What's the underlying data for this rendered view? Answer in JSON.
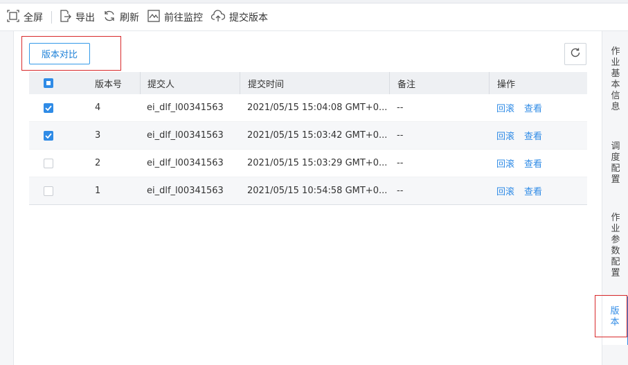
{
  "toolbar": {
    "fullscreen": "全屏",
    "export": "导出",
    "refresh": "刷新",
    "monitor": "前往监控",
    "submit": "提交版本"
  },
  "content": {
    "compare_button": "版本对比"
  },
  "table": {
    "headers": {
      "version": "版本号",
      "submitter": "提交人",
      "time": "提交时间",
      "note": "备注",
      "action": "操作"
    },
    "rows": [
      {
        "version": "4",
        "submitter": "ei_dlf_l00341563",
        "time": "2021/05/15 15:04:08 GMT+0...",
        "note": "--",
        "rollback": "回滚",
        "view": "查看",
        "checked": true
      },
      {
        "version": "3",
        "submitter": "ei_dlf_l00341563",
        "time": "2021/05/15 15:03:42 GMT+0...",
        "note": "--",
        "rollback": "回滚",
        "view": "查看",
        "checked": true
      },
      {
        "version": "2",
        "submitter": "ei_dlf_l00341563",
        "time": "2021/05/15 15:03:29 GMT+0...",
        "note": "--",
        "rollback": "回滚",
        "view": "查看",
        "checked": false
      },
      {
        "version": "1",
        "submitter": "ei_dlf_l00341563",
        "time": "2021/05/15 10:54:58 GMT+0...",
        "note": "--",
        "rollback": "回滚",
        "view": "查看",
        "checked": false
      }
    ]
  },
  "side_tabs": {
    "job_info": [
      "作",
      "业",
      "基",
      "本",
      "信",
      "息"
    ],
    "schedule": [
      "调",
      "度",
      "配",
      "置"
    ],
    "params": [
      "作",
      "业",
      "参",
      "数",
      "配",
      "置"
    ],
    "version": [
      "版",
      "本"
    ]
  },
  "colors": {
    "accent": "#2f8be6",
    "highlight_border": "#d8282a"
  }
}
